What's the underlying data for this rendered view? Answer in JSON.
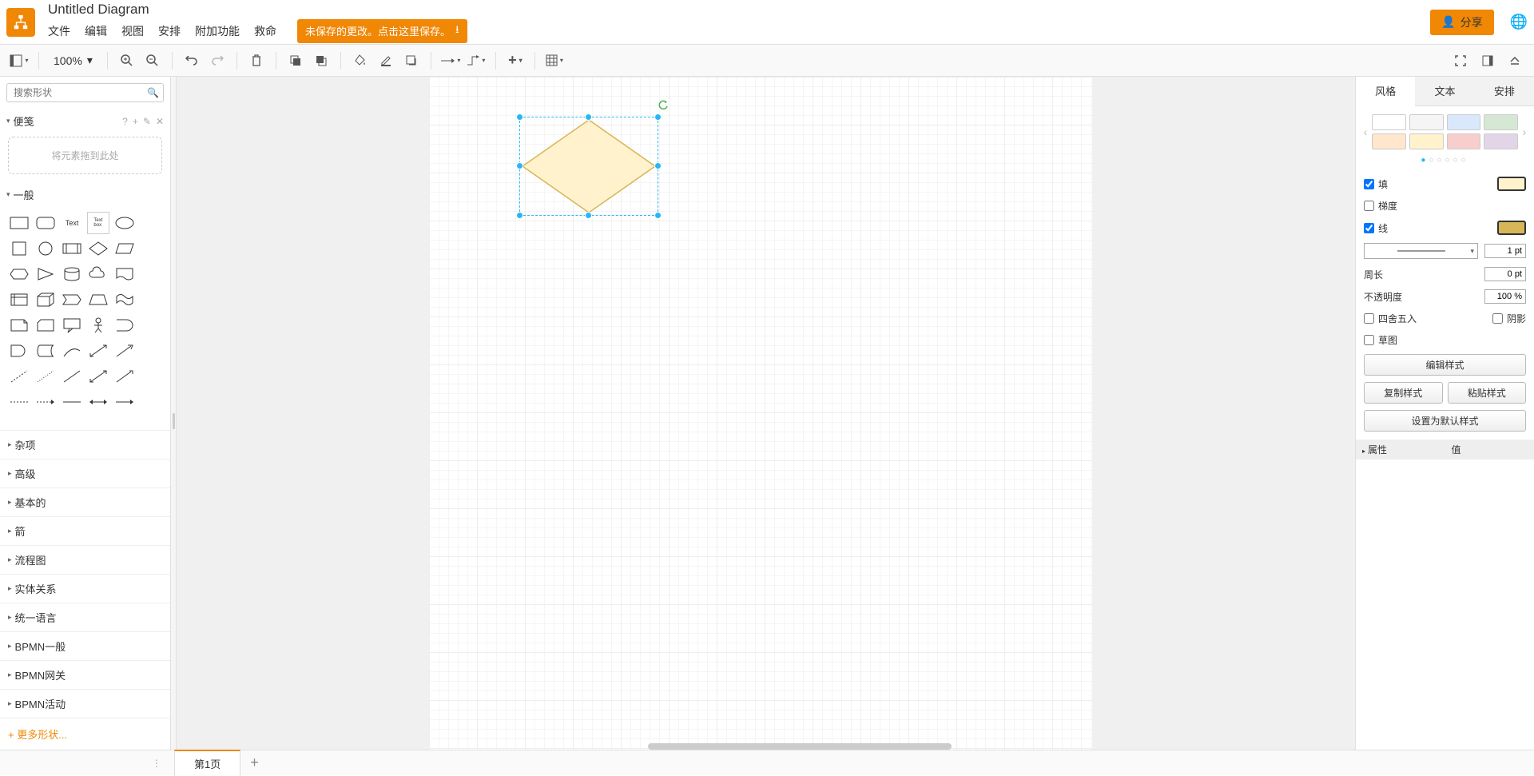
{
  "app": {
    "title": "Untitled Diagram"
  },
  "menubar": {
    "file": "文件",
    "edit": "编辑",
    "view": "视图",
    "arrange": "安排",
    "extras": "附加功能",
    "help": "救命"
  },
  "save_warning": "未保存的更改。点击这里保存。",
  "share": "分享",
  "toolbar": {
    "zoom": "100%"
  },
  "sidebar": {
    "search_placeholder": "搜索形状",
    "scratchpad": {
      "title": "便笺",
      "drop_hint": "将元素拖到此处"
    },
    "general_title": "一般",
    "categories": [
      "杂项",
      "高级",
      "基本的",
      "箭",
      "流程图",
      "实体关系",
      "统一语言",
      "BPMN一般",
      "BPMN网关",
      "BPMN活动"
    ],
    "more_shapes": "+ 更多形状..."
  },
  "right_panel": {
    "tabs": {
      "style": "风格",
      "text": "文本",
      "arrange": "安排"
    },
    "swatches_row1": [
      "#ffffff",
      "#f5f5f5",
      "#dae8fc",
      "#d5e8d4"
    ],
    "swatches_row2": [
      "#ffe6cc",
      "#fff2cc",
      "#f8cecc",
      "#e1d5e7"
    ],
    "fill_label": "填",
    "fill_color": "#fff2cc",
    "gradient_label": "梯度",
    "line_label": "线",
    "line_color": "#d6b656",
    "line_width": "1 pt",
    "perimeter_label": "周长",
    "perimeter_value": "0 pt",
    "opacity_label": "不透明度",
    "opacity_value": "100 %",
    "rounded_label": "四舍五入",
    "shadow_label": "阴影",
    "sketch_label": "草图",
    "edit_style": "编辑样式",
    "copy_style": "复制样式",
    "paste_style": "粘贴样式",
    "set_default": "设置为默认样式",
    "prop_attr": "属性",
    "prop_val": "值"
  },
  "footer": {
    "page1": "第1页"
  }
}
